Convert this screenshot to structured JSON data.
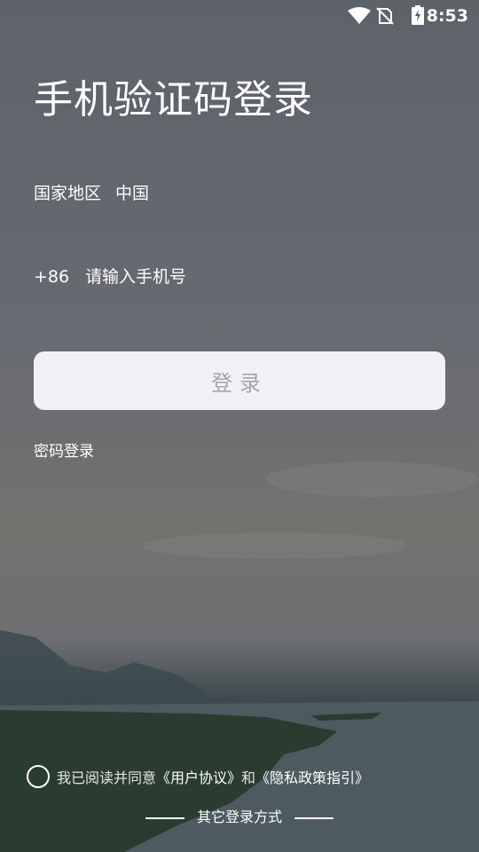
{
  "status_bar": {
    "time": "8:53",
    "icons": [
      "wifi-icon",
      "no-sim-icon",
      "battery-charging-icon"
    ]
  },
  "page": {
    "title": "手机验证码登录"
  },
  "region": {
    "label": "国家地区",
    "value": "中国"
  },
  "phone": {
    "prefix": "+86",
    "placeholder": "请输入手机号",
    "value": ""
  },
  "login_button": {
    "label": "登录"
  },
  "password_login": {
    "label": "密码登录"
  },
  "agreement": {
    "text": "我已阅读并同意",
    "user_agreement": "《用户协议》",
    "and": "和",
    "privacy_policy": "《隐私政策指引》",
    "checked": false
  },
  "other_login": {
    "label": "其它登录方式"
  },
  "colors": {
    "button_bg": "#f0f1f4",
    "button_text": "#a4a6ab",
    "text": "#ffffff"
  }
}
